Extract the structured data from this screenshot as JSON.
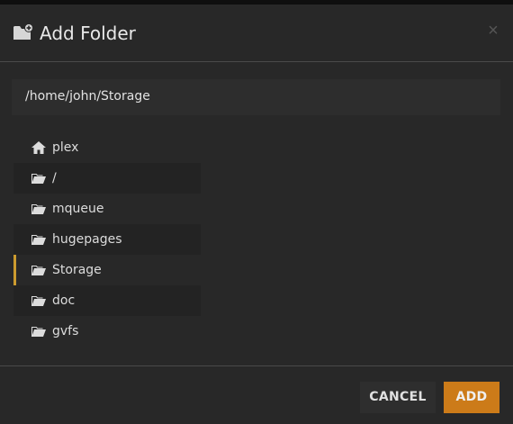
{
  "dialog": {
    "title": "Add Folder",
    "title_icon": "folder-plus-icon",
    "close_symbol": "×"
  },
  "path": {
    "value": "/home/john/Storage"
  },
  "folders": [
    {
      "label": "plex",
      "icon": "home-icon"
    },
    {
      "label": "/",
      "icon": "folder-open-icon"
    },
    {
      "label": "mqueue",
      "icon": "folder-open-icon"
    },
    {
      "label": "hugepages",
      "icon": "folder-open-icon"
    },
    {
      "label": "Storage",
      "icon": "folder-open-icon",
      "selected": true
    },
    {
      "label": "doc",
      "icon": "folder-open-icon"
    },
    {
      "label": "gvfs",
      "icon": "folder-open-icon"
    }
  ],
  "buttons": {
    "cancel_label": "CANCEL",
    "add_label": "ADD"
  },
  "colors": {
    "accent": "#cc7b19",
    "selection_bar": "#cc9b2f",
    "background": "#282828"
  }
}
